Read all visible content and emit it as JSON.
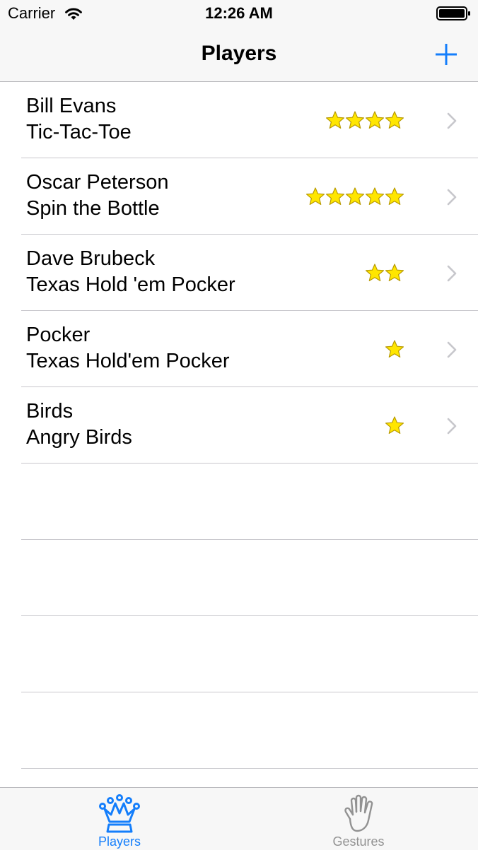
{
  "status_bar": {
    "carrier": "Carrier",
    "time": "12:26 AM",
    "icons": [
      "wifi-icon",
      "battery-icon"
    ]
  },
  "nav": {
    "title": "Players",
    "add_icon": "plus-icon",
    "accent_color": "#147efb"
  },
  "players": [
    {
      "name": "Bill Evans",
      "game": "Tic-Tac-Toe",
      "rating": 4
    },
    {
      "name": "Oscar Peterson",
      "game": "Spin the Bottle",
      "rating": 5
    },
    {
      "name": "Dave Brubeck",
      "game": "Texas Hold 'em Pocker",
      "rating": 2
    },
    {
      "name": "Pocker",
      "game": "Texas Hold'em Pocker",
      "rating": 1
    },
    {
      "name": "Birds",
      "game": "Angry Birds",
      "rating": 1
    }
  ],
  "empty_rows": 4,
  "star_color": "#ffe600",
  "tabs": [
    {
      "label": "Players",
      "icon": "crown-icon",
      "selected": true
    },
    {
      "label": "Gestures",
      "icon": "hand-icon",
      "selected": false
    }
  ]
}
